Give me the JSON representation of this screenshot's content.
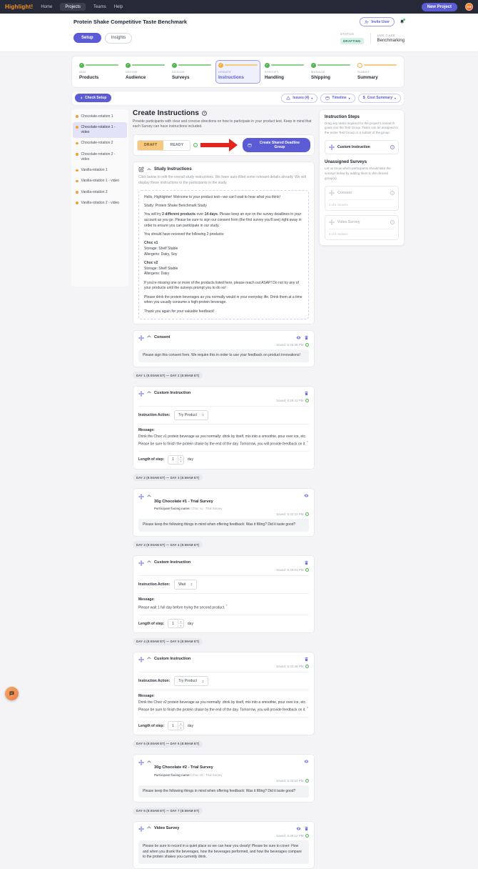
{
  "navbar": {
    "brand": "Highlight!",
    "home": "Home",
    "projects": "Projects",
    "teams": "Teams",
    "help": "Help",
    "new_project": "New Project",
    "avatar": "AS"
  },
  "header": {
    "title": "Protein Shake Competitive Taste Benchmark",
    "invite_user": "Invite User"
  },
  "tabs": {
    "setup": "Setup",
    "insights": "Insights",
    "status_label": "STATUS",
    "status_value": "DRAFTING",
    "use_case_label": "USE CASE",
    "use_case_value": "Benchmarking"
  },
  "stepper": {
    "steps": [
      {
        "kicker": "ADD",
        "label": "Products"
      },
      {
        "kicker": "DEFINE",
        "label": "Audience"
      },
      {
        "kicker": "DESIGN",
        "label": "Surveys"
      },
      {
        "kicker": "CREATE",
        "label": "Instructions"
      },
      {
        "kicker": "SPECIFY",
        "label": "Handling"
      },
      {
        "kicker": "MANAGE",
        "label": "Shipping"
      },
      {
        "kicker": "SUBMIT",
        "label": "Summary"
      }
    ]
  },
  "toolbar": {
    "check_setup": "Check Setup",
    "issues": "Issues (4)",
    "timeline": "Timeline",
    "cost_summary": "Cost Summary"
  },
  "sidebar": {
    "items": [
      {
        "label": "Chocolate-rotation 1"
      },
      {
        "label": "Chocolate-rotation 1 - video"
      },
      {
        "label": "Chocolate-rotation 2"
      },
      {
        "label": "Chocolate-rotation 2 - video"
      },
      {
        "label": "Vanilla-rotation 1"
      },
      {
        "label": "Vanilla-rotation 1 - video"
      },
      {
        "label": "Vanilla-rotation 2"
      },
      {
        "label": "Vanilla-rotation 2 - video"
      }
    ]
  },
  "main": {
    "title": "Create Instructions",
    "description": "Provide participants with clear and concise directions on how to participate in your product test. Keep in mind that each Survey can have instructions included.",
    "draft": "DRAFT",
    "ready": "READY",
    "deadline_button": "Create Shared Deadline Group",
    "labels": {
      "action": "Instruction Action:",
      "message": "Message:",
      "length": "Length of step:",
      "unit": "day",
      "facing": "Participant facing name:"
    },
    "study": {
      "title": "Study Instructions",
      "helper": "Click below to edit the overall study instructions. We have auto-filled some relevant details already. We will display these instructions to the participants in the study.",
      "p1": "Hello, Highlighter! Welcome to your product test—we can't wait to hear what you think!",
      "p2": "Study: Protein Shake Benchmark Study",
      "p3a": "You will try ",
      "p3b1": "2 different products",
      "p3c": " over ",
      "p3b2": "14 days",
      "p3d": ". Please keep an eye on the survey deadlines in your account as you go. Please be sure to sign our consent form (the first survey you'll see) right away in order to ensure you can participate in our study.",
      "p4": "You should have received the following 2 products:",
      "product1_name": "Choc v1",
      "product1_line1": "Storage: Shelf Stable",
      "product1_line2": "Allergens: Dairy, Soy",
      "product2_name": "Choc v2",
      "product2_line1": "Storage: Shelf Stable",
      "product2_line2": "Allergens: Dairy",
      "p5": "If you're missing one or more of the products listed here, please reach out ASAP! Do not try any of your products until the surveys prompt you to do so!",
      "p6": "Please drink the protein beverages as you normally would in your everyday life. Drink them at a time when you usually consume a high-protein beverage.",
      "p7": "Thank you again for your valuable feedback!"
    },
    "cards": {
      "consent": {
        "title": "Consent",
        "saved": "Saved: 5:26:58 PM",
        "message": "Please sign this consent form. We require this in order to use your feedback on product innovations!",
        "badge": "DAY 1 (9:00AM ET) — DAY 2 (8:59AM ET)"
      },
      "ci1": {
        "title": "Custom Instruction",
        "saved": "Saved: 5:29:41 PM",
        "action": "Try Product",
        "message": "Drink the Choc v1 protein beverage as you normally: drink by itself, mix into a smoothie, pour over ice, etc. Please be sure to finish the protein shake by the end of the day. Tomorrow, you will provide feedback on it.",
        "length_value": "1",
        "badge": "DAY 2 (9:00AM ET) — DAY 3 (8:59AM ET)"
      },
      "survey1": {
        "title": "30g Chocolate #1 - Trial Survey",
        "facing": "Choc v1 - Trial Survey",
        "saved": "Saved: 5:32:23 PM",
        "message": "Please keep the following things in mind when offering feedback: Was it filling? Did it taste good?",
        "badge": "DAY 3 (9:00AM ET) — DAY 4 (8:59AM ET)"
      },
      "ci2": {
        "title": "Custom Instruction",
        "saved": "Saved: 5:33:01 PM",
        "action": "Wait",
        "message": "Please wait 1 full day before trying the second product.",
        "length_value": "1",
        "badge": "DAY 4 (9:00AM ET) — DAY 5 (8:59AM ET)"
      },
      "ci3": {
        "title": "Custom Instruction",
        "saved": "Saved: 5:33:46 PM",
        "action": "Try Product",
        "message": "Drink the Choc v2 protein beverage as you normally: drink by itself, mix into a smoothie, pour over ice, etc. Please be sure to finish the protein shake by the end of the day. Tomorrow, you will provide feedback on it.",
        "length_value": "1",
        "badge": "DAY 5 (9:00AM ET) — DAY 6 (8:59AM ET)"
      },
      "survey2": {
        "title": "30g Chocolate #2 - Trial Survey",
        "facing": "Choc v2 - Trial Survey",
        "saved": "Saved: 5:33:54 PM",
        "message": "Please keep the following things in mind when offering feedback: Was it filling? Did it taste good?",
        "badge": "DAY 6 (9:00AM ET) — DAY 7 (8:59AM ET)"
      },
      "video": {
        "title": "Video Survey",
        "saved": "Saved: 5:36:12 PM",
        "message": "Please be sure to record in a quiet place so we can hear you clearly! Please be sure to cover: How and when you drank the beverages, how the beverages performed, and how the beverages compare to the protein shakes you currently drink."
      }
    }
  },
  "right_panel": {
    "title": "Instruction Steps",
    "description": "Drag any tasks required for the project's research goals into the Test Group. Tasks can be assigned to the entire Test Group or a subset of the group.",
    "custom_instruction": "Custom Instruction",
    "unassigned_title": "Unassigned Surveys",
    "unassigned_description": "Let us know which participants should take the surveys below by adding them to the desired group(s).",
    "consent_label": "Consent",
    "consent_variants": "4 of 8 Variants",
    "video_label": "Video Survey",
    "video_variants": "4 of 8 Variants"
  },
  "colors": {
    "accent": "#5b5bd6",
    "amber": "#f2b13c",
    "green": "#53b64f",
    "status_badge_bg": "#d9efe8",
    "status_badge_text": "#1e7d62",
    "arrow_red": "#e3251b"
  }
}
